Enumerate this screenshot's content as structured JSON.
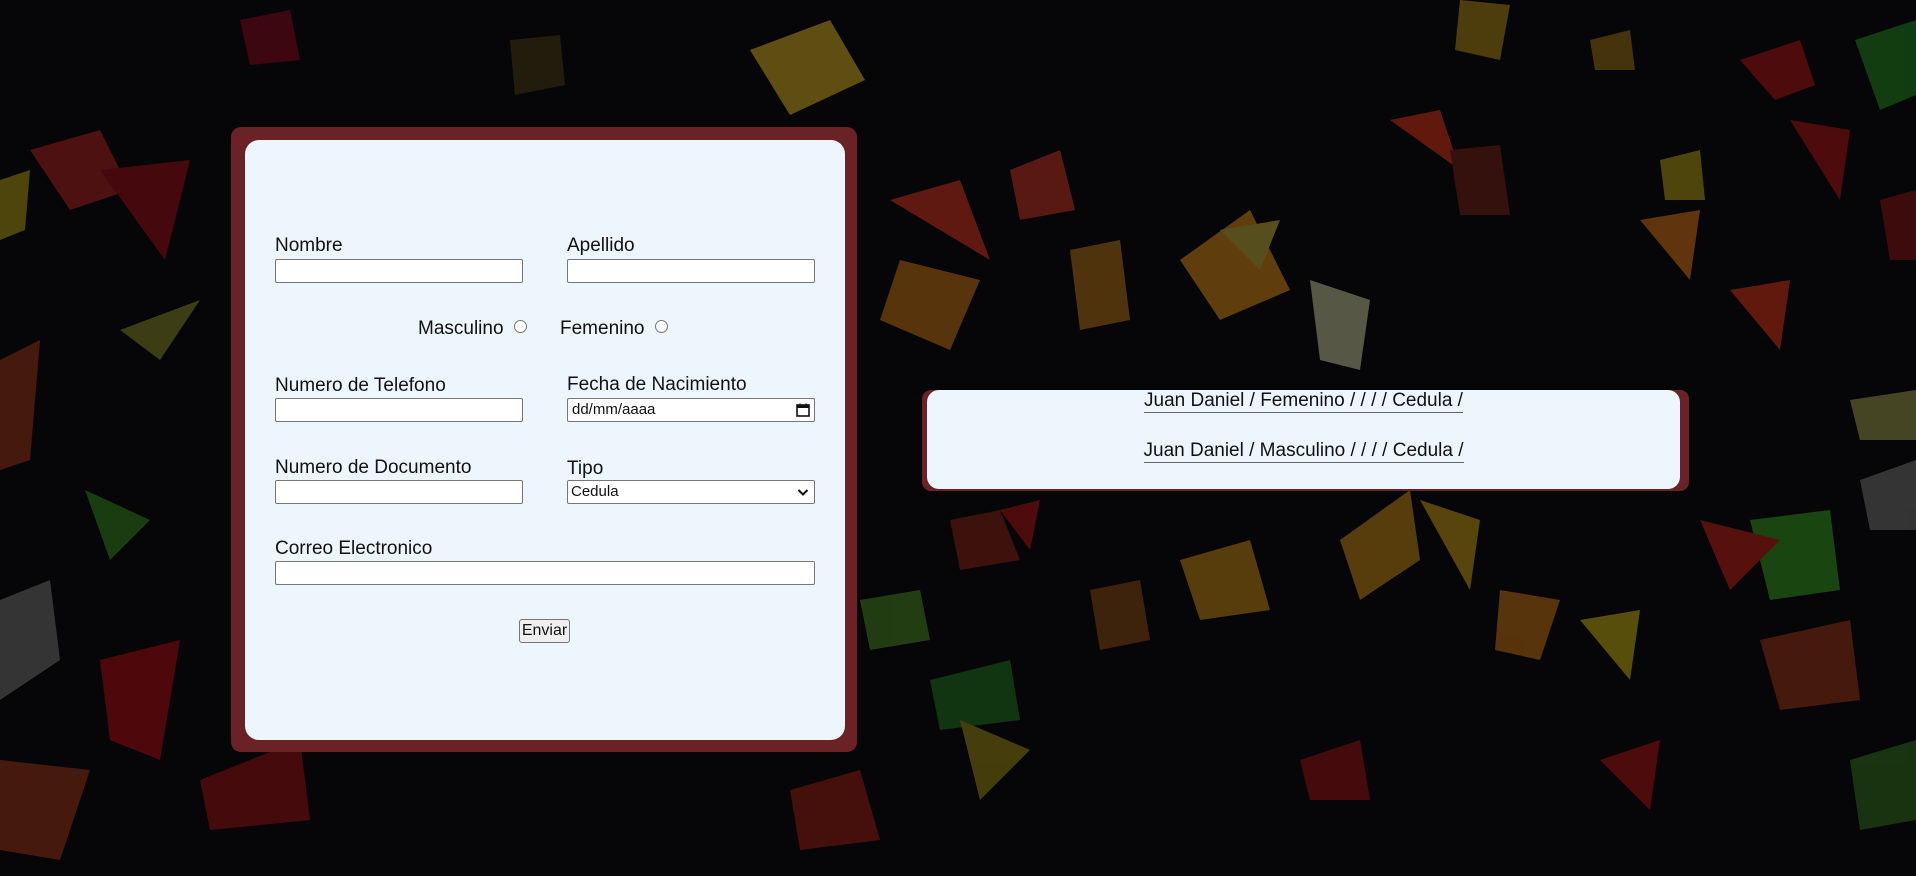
{
  "form": {
    "nombre_label": "Nombre",
    "nombre_value": "",
    "apellido_label": "Apellido",
    "apellido_value": "",
    "masculino_label": "Masculino",
    "femenino_label": "Femenino",
    "telefono_label": "Numero de Telefono",
    "telefono_value": "",
    "fecha_label": "Fecha de Nacimiento",
    "fecha_placeholder": "dd/mm/aaaa",
    "documento_label": "Numero de Documento",
    "documento_value": "",
    "tipo_label": "Tipo",
    "tipo_selected": "Cedula",
    "correo_label": "Correo Electronico",
    "correo_value": "",
    "submit_label": "Enviar"
  },
  "results": {
    "entries": [
      "Juan Daniel / Femenino / / / / Cedula /",
      "Juan Daniel / Masculino / / / / Cedula /"
    ]
  },
  "icons": {
    "calendar": "calendar-icon",
    "dropdown": "chevron-down-icon"
  },
  "colors": {
    "page_background": "#060608",
    "frame": "#6b2226",
    "card": "#edf5fd"
  }
}
